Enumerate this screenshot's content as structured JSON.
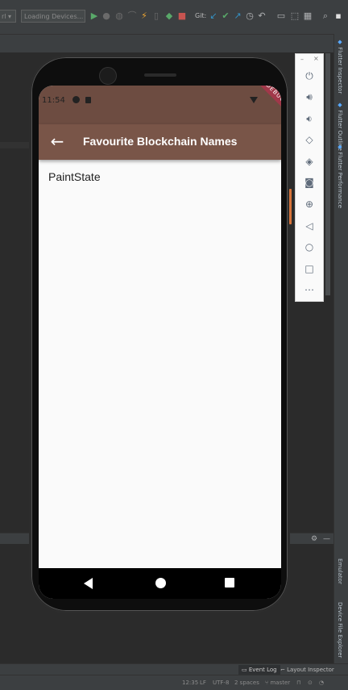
{
  "toolbar": {
    "config_combo": "rl",
    "device_combo": "Loading Devices...",
    "git_label": "Git:"
  },
  "emulator": {
    "status_time": "11:54",
    "debug_banner": "DEBUG",
    "appbar_title": "Favourite Blockchain Names",
    "body_text": "PaintState",
    "controls": [
      {
        "icon": "power-icon"
      },
      {
        "icon": "volume-up-icon"
      },
      {
        "icon": "volume-down-icon"
      },
      {
        "icon": "rotate-left-icon"
      },
      {
        "icon": "rotate-right-icon"
      },
      {
        "icon": "camera-icon"
      },
      {
        "icon": "zoom-icon"
      },
      {
        "icon": "back-icon"
      },
      {
        "icon": "home-icon"
      },
      {
        "icon": "overview-icon"
      },
      {
        "icon": "more-icon"
      }
    ]
  },
  "right_strip": {
    "tabs": [
      "Flutter Inspector",
      "Flutter Outline",
      "Flutter Performance",
      "Emulator",
      "Device File Explorer"
    ]
  },
  "tool_tabs": {
    "event_log": "Event Log",
    "layout_inspector": "Layout Inspector"
  },
  "status_bar": {
    "position": "12:35",
    "line_sep": "LF",
    "encoding": "UTF-8",
    "indent": "2 spaces",
    "branch": "master"
  }
}
